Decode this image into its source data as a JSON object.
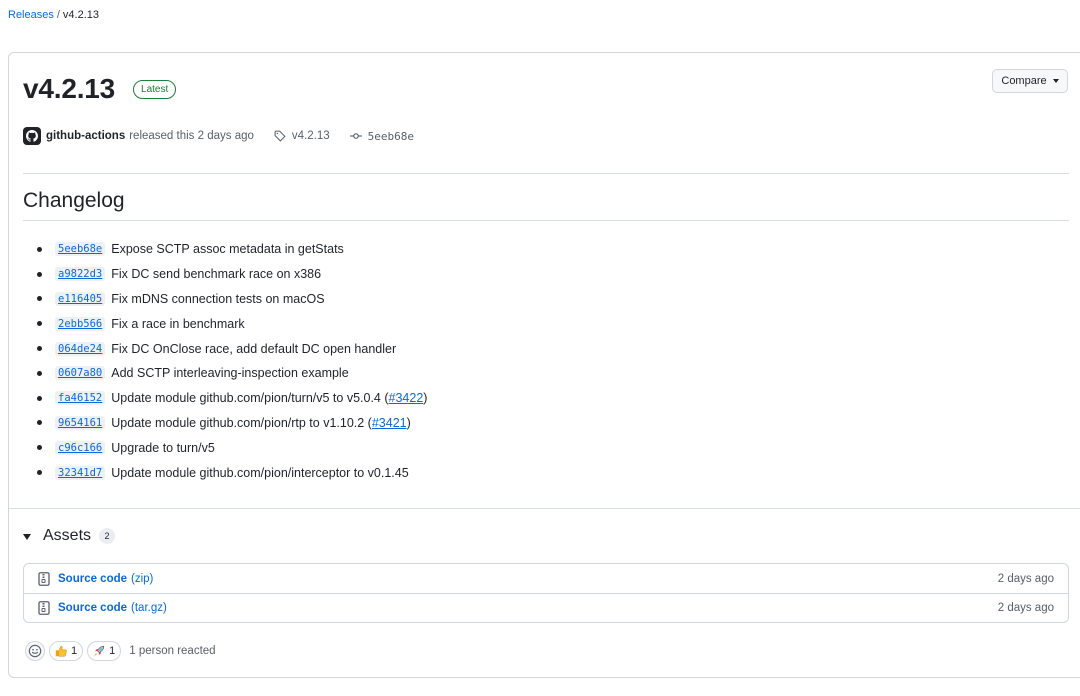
{
  "breadcrumb": {
    "root": "Releases",
    "separator": "/",
    "current": "v4.2.13"
  },
  "release": {
    "title": "v4.2.13",
    "badge": "Latest",
    "compare_label": "Compare",
    "author": "github-actions",
    "released_text": "released this 2 days ago",
    "tag": "v4.2.13",
    "commit": "5eeb68e"
  },
  "changelog": {
    "title": "Changelog",
    "items": [
      {
        "sha": "5eeb68e",
        "text": "Expose SCTP assoc metadata in getStats"
      },
      {
        "sha": "a9822d3",
        "text": "Fix DC send benchmark race on x386"
      },
      {
        "sha": "e116405",
        "text": "Fix mDNS connection tests on macOS"
      },
      {
        "sha": "2ebb566",
        "text": "Fix a race in benchmark"
      },
      {
        "sha": "064de24",
        "text": "Fix DC OnClose race, add default DC open handler"
      },
      {
        "sha": "0607a80",
        "text": "Add SCTP interleaving-inspection example"
      },
      {
        "sha": "fa46152",
        "text": "Update module github.com/pion/turn/v5 to v5.0.4 (",
        "pr": "#3422",
        "tail": ")"
      },
      {
        "sha": "9654161",
        "text": "Update module github.com/pion/rtp to v1.10.2 (",
        "pr": "#3421",
        "tail": ")"
      },
      {
        "sha": "c96c166",
        "text": "Upgrade to turn/v5"
      },
      {
        "sha": "32341d7",
        "text": "Update module github.com/pion/interceptor to v0.1.45"
      }
    ]
  },
  "assets": {
    "title": "Assets",
    "count": "2",
    "items": [
      {
        "name": "Source code",
        "ext": "(zip)",
        "time": "2 days ago"
      },
      {
        "name": "Source code",
        "ext": "(tar.gz)",
        "time": "2 days ago"
      }
    ]
  },
  "reactions": {
    "thumbs_count": "1",
    "rocket_count": "1",
    "summary": "1 person reacted"
  },
  "icons": [
    "smiley-icon",
    "thumbs-up-icon",
    "rocket-icon",
    "tag-icon",
    "commit-icon",
    "file-zip-icon",
    "github-avatar-icon",
    "triangle-down-icon"
  ],
  "colors": {
    "link": "#0969da",
    "latest_badge": "#1a7f37",
    "border": "#d0d7de"
  }
}
